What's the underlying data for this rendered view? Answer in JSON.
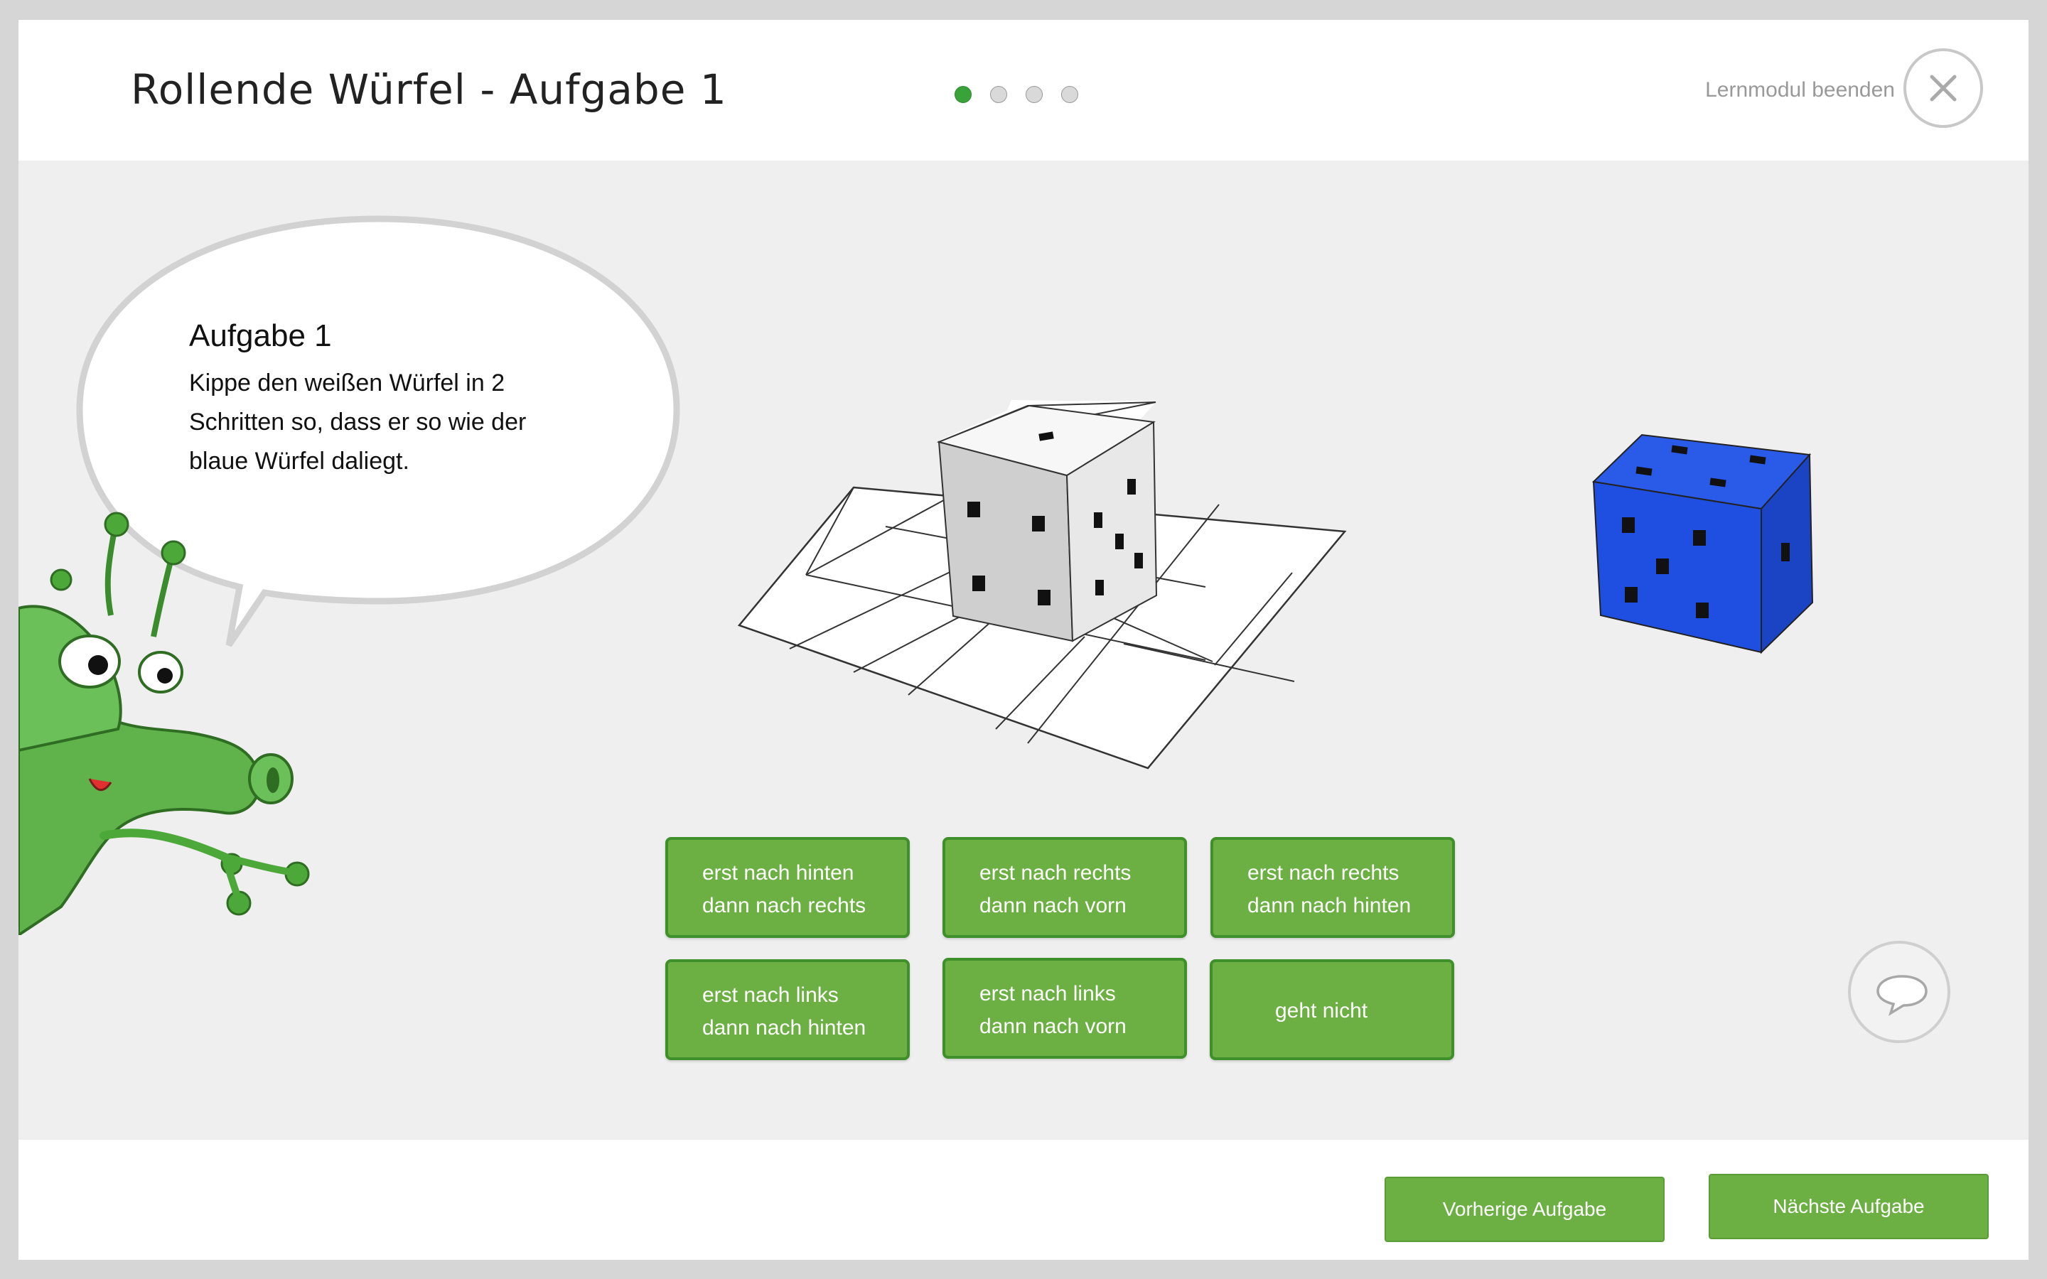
{
  "header": {
    "title": "Rollende Würfel - Aufgabe 1",
    "progress": {
      "total": 4,
      "current": 1
    },
    "quit_label": "Lernmodul beenden"
  },
  "task": {
    "heading": "Aufgabe 1",
    "text": "Kippe den weißen Würfel in 2 Schritten so, dass er so wie der blaue Würfel daliegt."
  },
  "answers": [
    {
      "line1": "erst nach hinten",
      "line2": "dann nach rechts"
    },
    {
      "line1": "erst nach rechts",
      "line2": "dann nach vorn"
    },
    {
      "line1": "erst nach rechts",
      "line2": "dann nach hinten"
    },
    {
      "line1": "erst nach links",
      "line2": "dann nach hinten"
    },
    {
      "line1": "erst nach links",
      "line2": "dann nach vorn"
    },
    {
      "line1": "geht nicht",
      "line2": ""
    }
  ],
  "footer": {
    "prev_label": "Vorherige Aufgabe",
    "next_label": "Nächste Aufgabe"
  },
  "colors": {
    "accent_green": "#6cb043",
    "blue_cube": "#1f4fe0",
    "white_cube": "#e6e6e6"
  }
}
